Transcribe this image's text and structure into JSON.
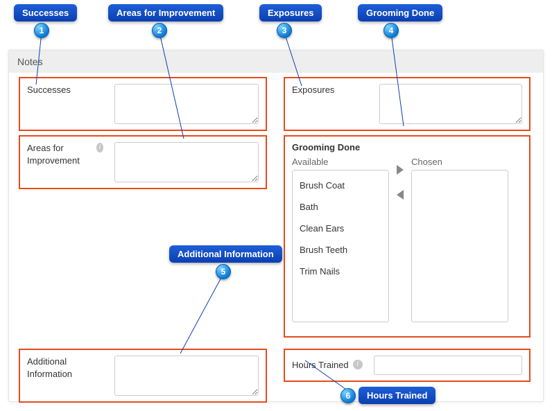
{
  "header": {
    "title": "Notes"
  },
  "callouts": {
    "c1": "Successes",
    "c2": "Areas for Improvement",
    "c3": "Exposures",
    "c4": "Grooming Done",
    "c5": "Additional Information",
    "c6": "Hours Trained"
  },
  "nums": {
    "n1": "1",
    "n2": "2",
    "n3": "3",
    "n4": "4",
    "n5": "5",
    "n6": "6"
  },
  "fields": {
    "successes": {
      "label": "Successes",
      "value": ""
    },
    "exposures": {
      "label": "Exposures",
      "value": ""
    },
    "areas": {
      "label": "Areas for Improvement",
      "value": ""
    },
    "additional": {
      "label": "Additional Information",
      "value": ""
    },
    "hours": {
      "label": "Hours Trained",
      "value": ""
    }
  },
  "grooming": {
    "title": "Grooming Done",
    "available_label": "Available",
    "chosen_label": "Chosen",
    "available": [
      "Brush Coat",
      "Bath",
      "Clean Ears",
      "Brush Teeth",
      "Trim Nails"
    ],
    "chosen": []
  }
}
